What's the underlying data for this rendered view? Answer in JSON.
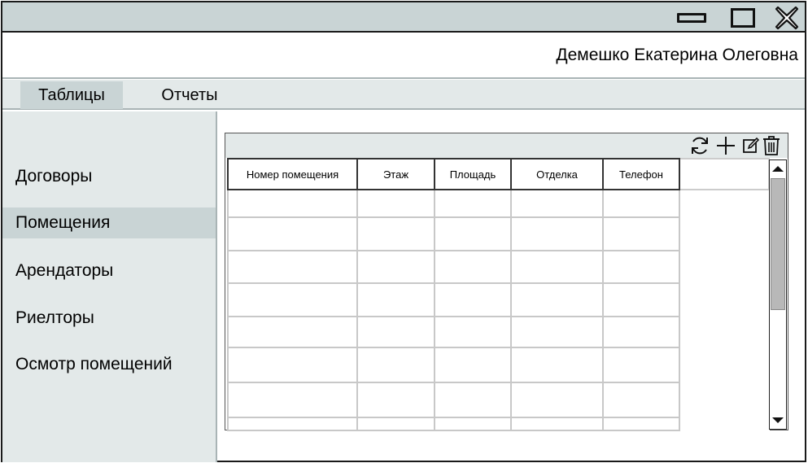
{
  "window": {
    "minimize_icon": "minimize-icon",
    "maximize_icon": "maximize-icon",
    "close_icon": "close-icon"
  },
  "header": {
    "user_name": "Демешко Екатерина Олеговна"
  },
  "menu": {
    "items": [
      {
        "label": "Таблицы",
        "active": true
      },
      {
        "label": "Отчеты",
        "active": false
      }
    ]
  },
  "sidebar": {
    "items": [
      {
        "label": "Договоры",
        "active": false
      },
      {
        "label": "Помещения",
        "active": true
      },
      {
        "label": "Арендаторы",
        "active": false
      },
      {
        "label": "Риелторы",
        "active": false
      },
      {
        "label": "Осмотр помещений",
        "active": false
      }
    ]
  },
  "toolbar": {
    "icons": [
      "refresh-icon",
      "add-icon",
      "edit-icon",
      "delete-icon"
    ]
  },
  "table": {
    "columns": [
      "Номер помещения",
      "Этаж",
      "Площадь",
      "Отделка",
      "Телефон",
      ""
    ],
    "rows": [
      [
        "",
        "",
        "",
        "",
        "",
        ""
      ],
      [
        "",
        "",
        "",
        "",
        "",
        ""
      ],
      [
        "",
        "",
        "",
        "",
        "",
        ""
      ],
      [
        "",
        "",
        "",
        "",
        "",
        ""
      ],
      [
        "",
        "",
        "",
        "",
        "",
        ""
      ],
      [
        "",
        "",
        "",
        "",
        "",
        ""
      ],
      [
        "",
        "",
        "",
        "",
        "",
        ""
      ],
      [
        "",
        "",
        "",
        "",
        "",
        ""
      ]
    ]
  },
  "colors": {
    "titlebar": "#c9d4d5",
    "panel": "#e3e9e9",
    "active": "#c9d4d5",
    "border": "#1a1a1a"
  }
}
